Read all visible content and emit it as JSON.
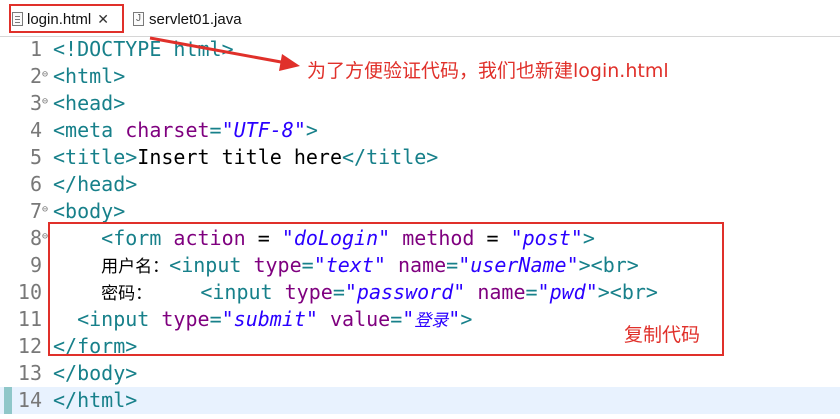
{
  "tabs": [
    {
      "label": "login.html",
      "close": "✕",
      "active": true
    },
    {
      "label": "servlet01.java",
      "active": false
    }
  ],
  "lines": [
    {
      "num": "1",
      "fold": "",
      "parts": [
        [
          "tag",
          "<!DOCTYPE html>"
        ]
      ]
    },
    {
      "num": "2",
      "fold": "⊖",
      "parts": [
        [
          "tag",
          "<html>"
        ]
      ]
    },
    {
      "num": "3",
      "fold": "⊖",
      "parts": [
        [
          "tag",
          "<head>"
        ]
      ]
    },
    {
      "num": "4",
      "fold": "",
      "parts": [
        [
          "tag",
          "<meta "
        ],
        [
          "attr",
          "charset"
        ],
        [
          "tag",
          "="
        ],
        [
          "str",
          "\"UTF-8\""
        ],
        [
          "tag",
          ">"
        ]
      ]
    },
    {
      "num": "5",
      "fold": "",
      "parts": [
        [
          "tag",
          "<title>"
        ],
        [
          "txt",
          "Insert title here"
        ],
        [
          "tag",
          "</title>"
        ]
      ]
    },
    {
      "num": "6",
      "fold": "",
      "parts": [
        [
          "tag",
          "</head>"
        ]
      ]
    },
    {
      "num": "7",
      "fold": "⊖",
      "parts": [
        [
          "tag",
          "<body>"
        ]
      ]
    },
    {
      "num": "8",
      "fold": "⊖",
      "parts": [
        [
          "txt",
          "    "
        ],
        [
          "tag",
          "<form "
        ],
        [
          "attr",
          "action"
        ],
        [
          "txt",
          " = "
        ],
        [
          "str",
          "\"doLogin\""
        ],
        [
          "txt",
          " "
        ],
        [
          "attr",
          "method"
        ],
        [
          "txt",
          " = "
        ],
        [
          "str",
          "\"post\""
        ],
        [
          "tag",
          ">"
        ]
      ]
    },
    {
      "num": "9",
      "fold": "",
      "parts": [
        [
          "txt",
          "    "
        ],
        [
          "cn",
          "用户名："
        ],
        [
          "tag",
          "<input "
        ],
        [
          "attr",
          "type"
        ],
        [
          "tag",
          "="
        ],
        [
          "str",
          "\"text\""
        ],
        [
          "txt",
          " "
        ],
        [
          "attr",
          "name"
        ],
        [
          "tag",
          "="
        ],
        [
          "str",
          "\"userName\""
        ],
        [
          "tag",
          "><br>"
        ]
      ]
    },
    {
      "num": "10",
      "fold": "",
      "parts": [
        [
          "txt",
          "    "
        ],
        [
          "cn",
          "密码："
        ],
        [
          "txt",
          "    "
        ],
        [
          "tag",
          "<input "
        ],
        [
          "attr",
          "type"
        ],
        [
          "tag",
          "="
        ],
        [
          "str",
          "\"password\""
        ],
        [
          "txt",
          " "
        ],
        [
          "attr",
          "name"
        ],
        [
          "tag",
          "="
        ],
        [
          "str",
          "\"pwd\""
        ],
        [
          "tag",
          "><br>"
        ]
      ]
    },
    {
      "num": "11",
      "fold": "",
      "parts": [
        [
          "txt",
          "  "
        ],
        [
          "tag",
          "<input "
        ],
        [
          "attr",
          "type"
        ],
        [
          "tag",
          "="
        ],
        [
          "str",
          "\"submit\""
        ],
        [
          "txt",
          " "
        ],
        [
          "attr",
          "value"
        ],
        [
          "tag",
          "="
        ],
        [
          "str",
          "\""
        ],
        [
          "cn-it",
          "登录"
        ],
        [
          "str",
          "\""
        ],
        [
          "tag",
          ">"
        ]
      ]
    },
    {
      "num": "12",
      "fold": "",
      "parts": [
        [
          "tag",
          "</form>"
        ]
      ]
    },
    {
      "num": "13",
      "fold": "",
      "parts": [
        [
          "tag",
          "</body>"
        ]
      ]
    },
    {
      "num": "14",
      "fold": "",
      "parts": [
        [
          "tag",
          "</html>"
        ]
      ],
      "current": true
    }
  ],
  "annotations": {
    "note1": "为了方便验证代码，我们也新建login.html",
    "note2": "复制代码",
    "color": "#e0302a"
  }
}
